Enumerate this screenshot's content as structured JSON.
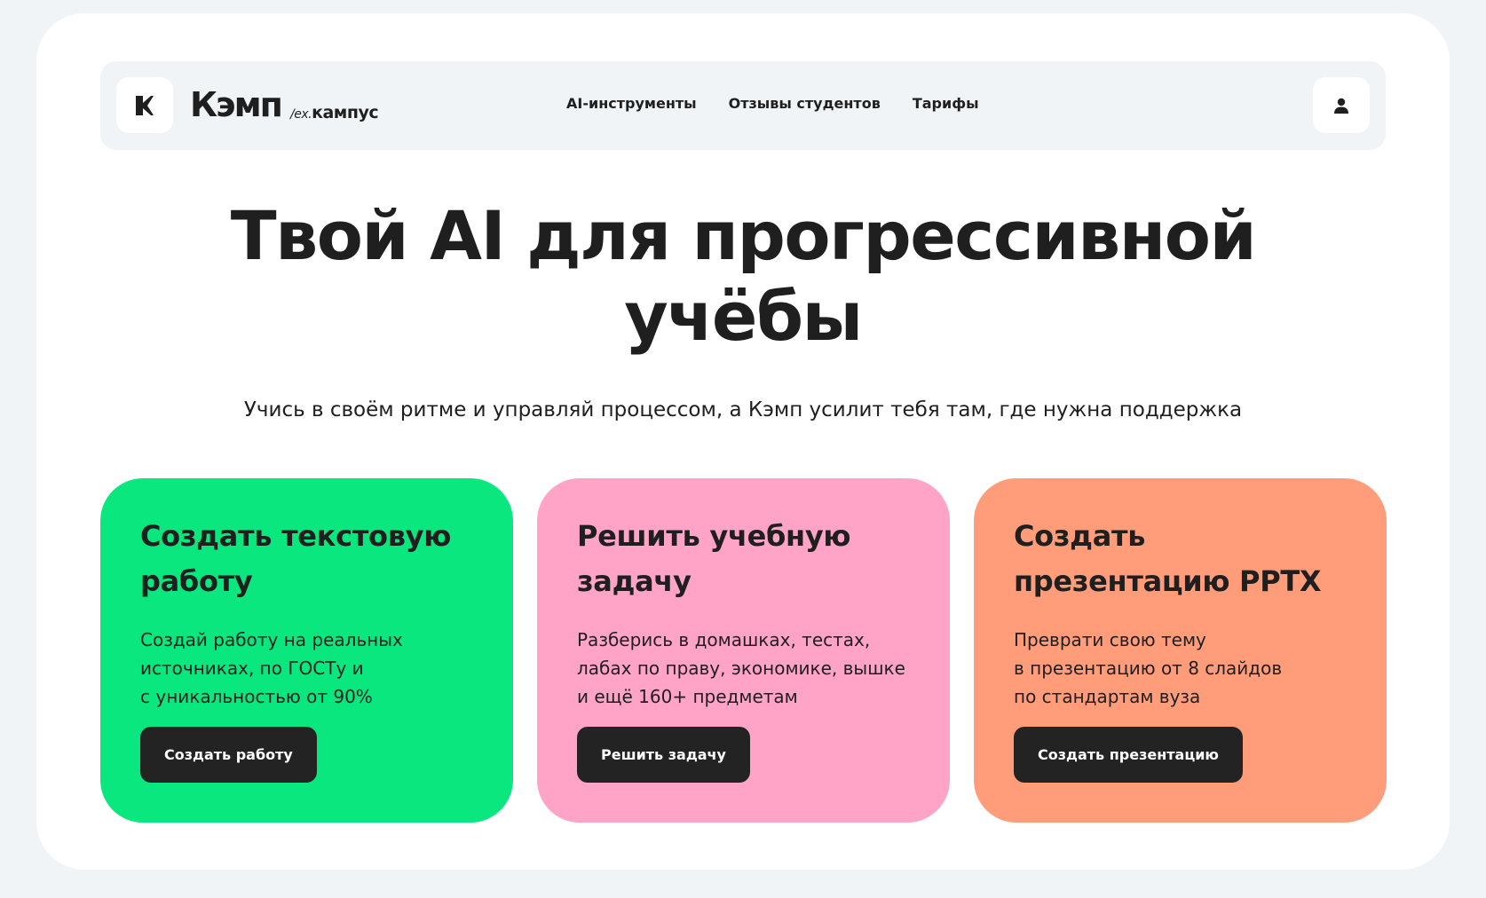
{
  "header": {
    "brand": "Кэмп",
    "brand_sub_prefix": "/ex.",
    "brand_sub": "кампус",
    "nav": [
      {
        "label": "AI-инструменты"
      },
      {
        "label": "Отзывы студентов"
      },
      {
        "label": "Тарифы"
      }
    ]
  },
  "hero": {
    "title_line1": "Твой AI для прогрессивной",
    "title_line2": "учёбы",
    "subtitle": "Учись в своём ритме и управляй процессом, а Кэмп усилит тебя там, где нужна поддержка"
  },
  "cards": [
    {
      "title_line1": "Создать текстовую",
      "title_line2": "работу",
      "desc_line1": "Создай работу на реальных",
      "desc_line2": "источниках, по ГОСТу и",
      "desc_line3": "с уникальностью от 90%",
      "button": "Создать работу",
      "color": "#0be77f"
    },
    {
      "title_line1": "Решить учебную",
      "title_line2": "задачу",
      "desc_line1": "Разберись в домашках, тестах,",
      "desc_line2": "лабах по праву, экономике, вышке",
      "desc_line3": "и ещё 160+ предметам",
      "button": "Решить задачу",
      "color": "#ffa3c7"
    },
    {
      "title_line1": "Создать",
      "title_line2": "презентацию PPTX",
      "desc_line1": "Преврати свою тему",
      "desc_line2": "в презентацию от 8 слайдов",
      "desc_line3": "по стандартам вуза",
      "button": "Создать презентацию",
      "color": "#ff9d7b"
    }
  ],
  "colors": {
    "background": "#f1f4f7",
    "surface": "#ffffff",
    "text": "#1f1f1f",
    "button": "#232323"
  },
  "icons": {
    "logo": "kemp-logo-icon",
    "user": "user-icon"
  }
}
